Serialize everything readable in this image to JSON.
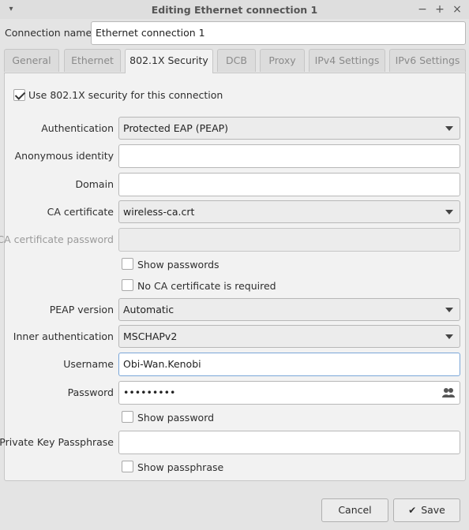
{
  "window": {
    "title": "Editing Ethernet connection 1",
    "menu_glyph": "▾",
    "minimize_glyph": "−",
    "maximize_glyph": "+",
    "close_glyph": "×"
  },
  "connection": {
    "name_label": "Connection name",
    "name_value": "Ethernet connection 1"
  },
  "tabs": [
    {
      "label": "General",
      "active": false
    },
    {
      "label": "Ethernet",
      "active": false
    },
    {
      "label": "802.1X Security",
      "active": true
    },
    {
      "label": "DCB",
      "active": false
    },
    {
      "label": "Proxy",
      "active": false
    },
    {
      "label": "IPv4 Settings",
      "active": false
    },
    {
      "label": "IPv6 Settings",
      "active": false
    }
  ],
  "security": {
    "use_8021x": {
      "label": "Use 802.1X security for this connection",
      "checked": true
    },
    "authentication": {
      "label": "Authentication",
      "value": "Protected EAP (PEAP)"
    },
    "anonymous_identity": {
      "label": "Anonymous identity",
      "value": ""
    },
    "domain": {
      "label": "Domain",
      "value": ""
    },
    "ca_certificate": {
      "label": "CA certificate",
      "value": "wireless-ca.crt"
    },
    "ca_certificate_password": {
      "label": "CA certificate password",
      "value": ""
    },
    "show_passwords": {
      "label": "Show passwords",
      "checked": false
    },
    "no_ca_required": {
      "label": "No CA certificate is required",
      "checked": false
    },
    "peap_version": {
      "label": "PEAP version",
      "value": "Automatic"
    },
    "inner_authentication": {
      "label": "Inner authentication",
      "value": "MSCHAPv2"
    },
    "username": {
      "label": "Username",
      "value": "Obi-Wan.Kenobi"
    },
    "password": {
      "label": "Password",
      "value": "•••••••••"
    },
    "show_password": {
      "label": "Show password",
      "checked": false
    },
    "private_key_passphrase": {
      "label": "Private Key Passphrase",
      "value": ""
    },
    "show_passphrase": {
      "label": "Show passphrase",
      "checked": false
    }
  },
  "footer": {
    "cancel_label": "Cancel",
    "save_label": "Save",
    "save_glyph": "✔"
  }
}
